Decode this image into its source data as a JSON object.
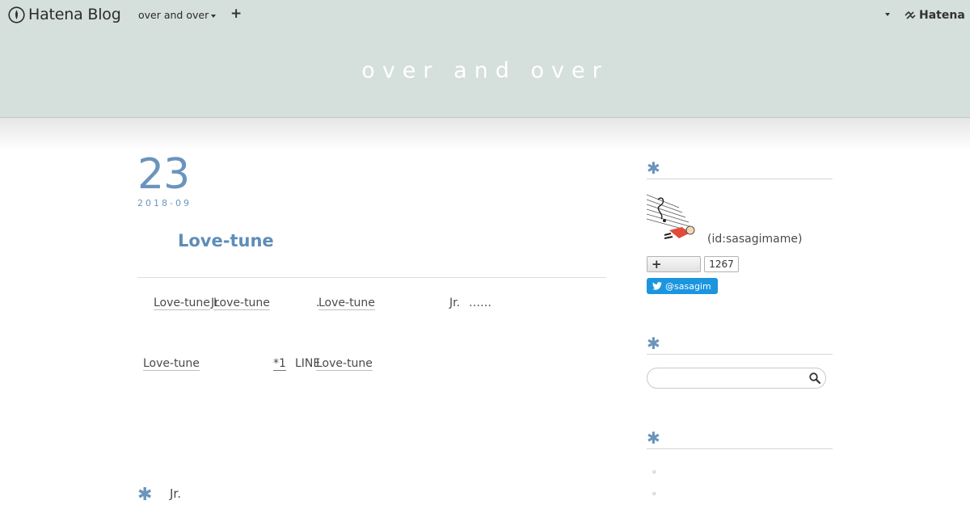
{
  "header": {
    "logo_text": "Hatena Blog",
    "blog_menu_label": "over and over",
    "add_label": "+",
    "hatena_label": "Hatena"
  },
  "blog": {
    "title": "over and over"
  },
  "entry": {
    "day": "23",
    "year_month": "2018-09",
    "title": "Love-tune",
    "line1": {
      "kw1": "Love-tune",
      "jr1": "Jr",
      "kw2": "Love-tune",
      "dot": ".",
      "kw3": "Love-tune",
      "jr2": "Jr.",
      "ellipsis": "……"
    },
    "line2": {
      "kw1": "Love-tune",
      "footnote": "*1",
      "line_text": "LINE",
      "kw2": "Love-tune"
    },
    "section_star": "✱",
    "section_text": "Jr."
  },
  "sidebar": {
    "profile_star": "✱",
    "profile_id": "(id:sasagimame)",
    "subscribe_plus": "+",
    "subscribe_count": "1267",
    "twitter_label": "@sasagim",
    "search_star": "✱",
    "search_placeholder": "",
    "archive_star": "✱",
    "archive_items": [
      "◦",
      "◦"
    ]
  },
  "colors": {
    "accent": "#6a94bd",
    "banner": "#d5dfdb",
    "twitter": "#1b95e0"
  }
}
